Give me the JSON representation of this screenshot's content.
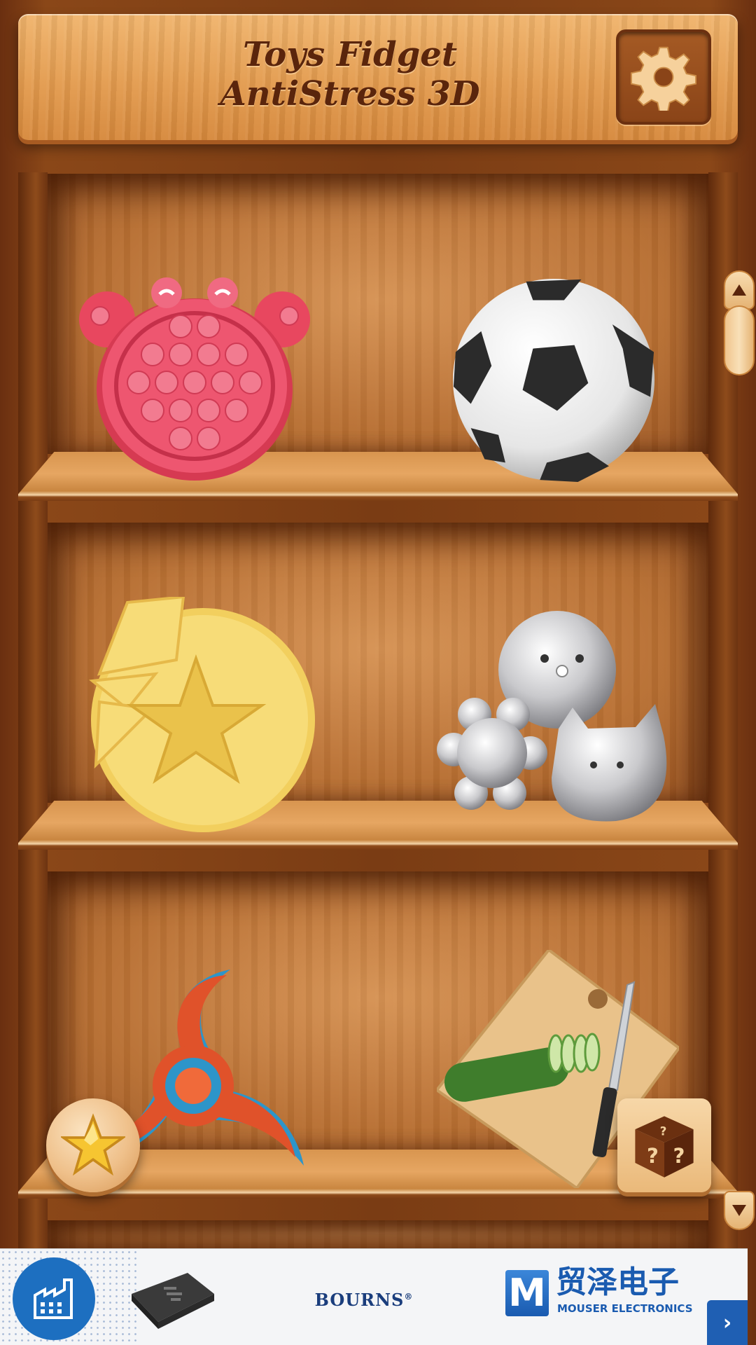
{
  "header": {
    "title_line1": "Toys Fidget",
    "title_line2": "AntiStress 3D",
    "settings_icon": "gear-icon"
  },
  "shelves": [
    {
      "items": [
        {
          "name": "pop-it-crab",
          "color": "#e8475f"
        },
        {
          "name": "soccer-ball",
          "color": "#ffffff"
        }
      ]
    },
    {
      "items": [
        {
          "name": "dalgona-star-candy",
          "color": "#f2cf5e"
        },
        {
          "name": "silver-squishies",
          "color": "#c9c9cc"
        }
      ]
    },
    {
      "items": [
        {
          "name": "fidget-spinner",
          "color": "#e0522a"
        },
        {
          "name": "cucumber-cutting-board",
          "color": "#e9c28a"
        }
      ]
    }
  ],
  "buttons": {
    "favorites_icon": "star-icon",
    "random_icon": "mystery-dice-icon",
    "scroll_up_icon": "arrow-up-icon",
    "scroll_down_icon": "arrow-down-icon"
  },
  "ad": {
    "brand1": "BOURNS",
    "brand1_mark": "®",
    "brand2_logo_letter": "M",
    "brand2_cn": "贸泽电子",
    "brand2_en": "MOUSER ELECTRONICS",
    "next_label": "›"
  },
  "colors": {
    "wood_dark": "#6b2f0f",
    "wood_light": "#e39b4e",
    "title_text": "#5a250c",
    "ad_blue": "#1f5fb3"
  }
}
